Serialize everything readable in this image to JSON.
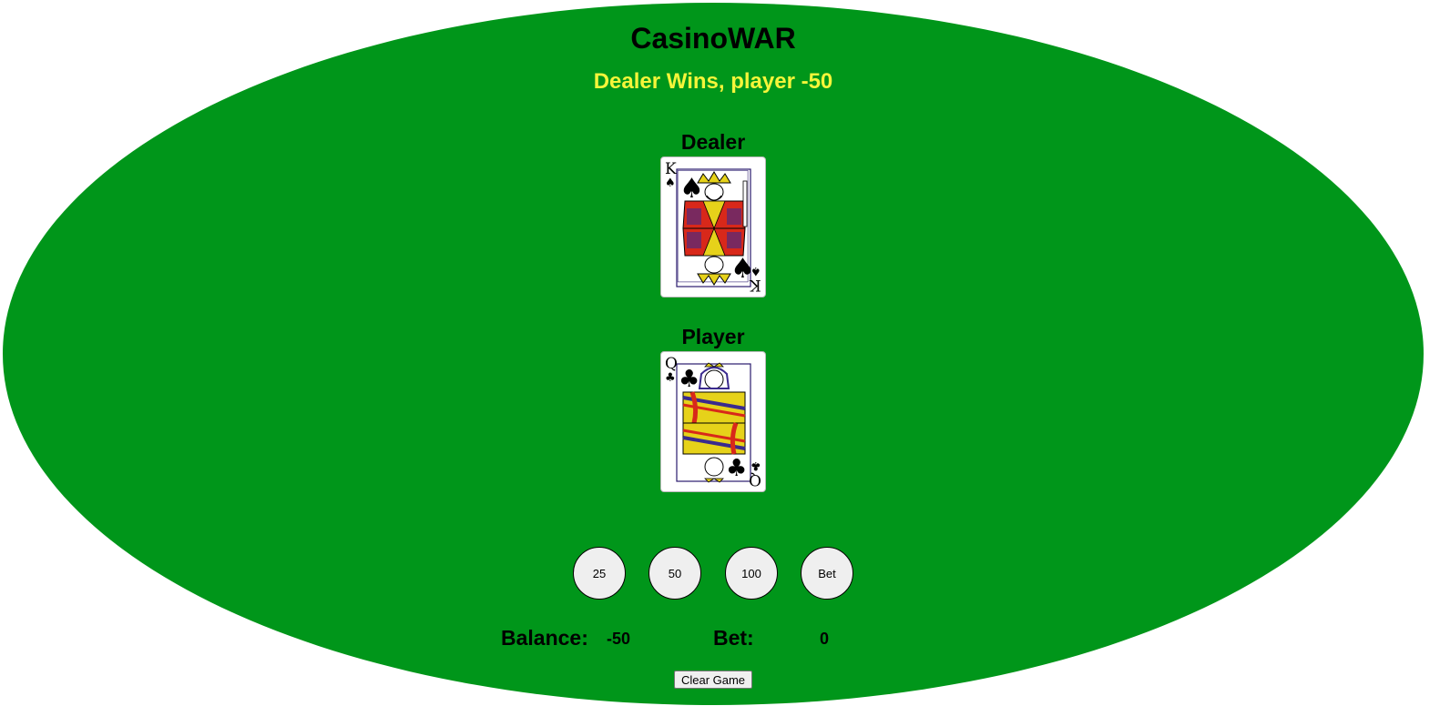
{
  "game": {
    "title": "CasinoWAR",
    "status_message": "Dealer Wins, player -50",
    "status_color": "#f5f53a",
    "table_color": "#00961a"
  },
  "dealer": {
    "label": "Dealer",
    "card": {
      "rank": "K",
      "suit": "spades",
      "suit_symbol": "♠"
    }
  },
  "player": {
    "label": "Player",
    "card": {
      "rank": "Q",
      "suit": "clubs",
      "suit_symbol": "♣"
    }
  },
  "chips": [
    {
      "label": "25"
    },
    {
      "label": "50"
    },
    {
      "label": "100"
    },
    {
      "label": "Bet"
    }
  ],
  "balance": {
    "label": "Balance:",
    "value": "-50"
  },
  "bet": {
    "label": "Bet:",
    "value": "0"
  },
  "clear_button": {
    "label": "Clear Game"
  }
}
